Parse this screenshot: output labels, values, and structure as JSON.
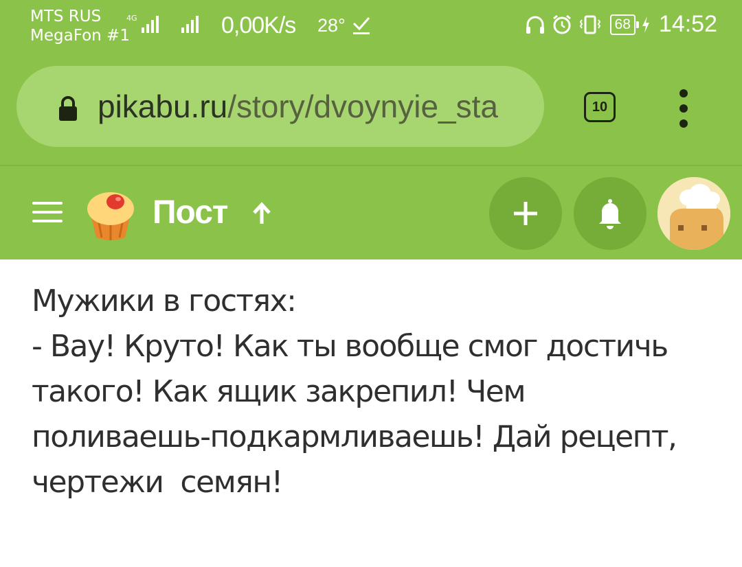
{
  "status_bar": {
    "carrier1": "MTS RUS",
    "carrier2": "MegaFon #1",
    "network_type": "4G",
    "net_speed": "0,00K/s",
    "temperature": "28°",
    "battery": "68",
    "time": "14:52",
    "icons": [
      "signal-icon",
      "signal-icon",
      "download-check-icon",
      "headphones-icon",
      "alarm-icon",
      "vibrate-icon",
      "battery-icon",
      "charging-icon"
    ]
  },
  "browser": {
    "url_host": "pikabu.ru",
    "url_path": "/story/dvoynyie_sta",
    "tab_count": "10",
    "colors": {
      "bar": "#8bc34a",
      "field": "#a7d56f"
    }
  },
  "app_header": {
    "title": "Пост",
    "accent": "#8bc34a",
    "button_bg": "#76ac38"
  },
  "post": {
    "lines": [
      "Мужики в гостях:",
      "- Вау! Круто! Как ты вообще смог достичь",
      "такого! Как ящик закрепил! Чем",
      "поливаешь-подкармливаешь! Дай рецепт,",
      "чертежи  семян!"
    ]
  }
}
